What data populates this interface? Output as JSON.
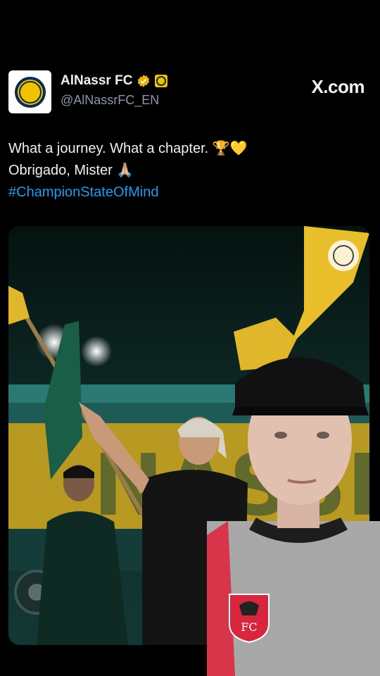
{
  "account": {
    "display_name": "AlNassr FC",
    "handle": "@AlNassrFC_EN",
    "avatar_icon": "alnassr-crest-icon"
  },
  "brand": {
    "label": "X.com"
  },
  "tweet": {
    "line1": "What a journey. What a chapter. 🏆💛",
    "line2": "Obrigado, Mister 🙏🏼",
    "hashtag": "#ChampionStateOfMind"
  },
  "colors": {
    "background": "#000000",
    "hashtag": "#1d9bf0",
    "club_yellow": "#f2c200",
    "club_navy": "#0b2b55"
  }
}
